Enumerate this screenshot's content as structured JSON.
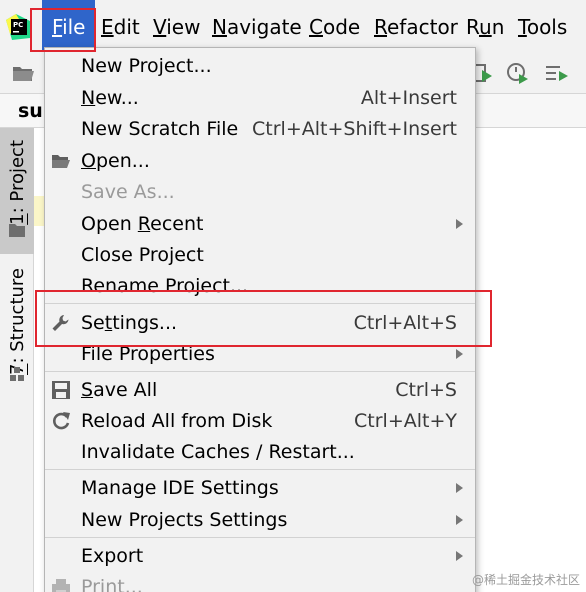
{
  "menubar": {
    "items": [
      {
        "pre": "",
        "mn": "F",
        "post": "ile"
      },
      {
        "pre": "",
        "mn": "E",
        "post": "dit"
      },
      {
        "pre": "",
        "mn": "V",
        "post": "iew"
      },
      {
        "pre": "",
        "mn": "N",
        "post": "avigate"
      },
      {
        "pre": "",
        "mn": "C",
        "post": "ode"
      },
      {
        "pre": "",
        "mn": "R",
        "post": "efactor"
      },
      {
        "pre": "R",
        "mn": "u",
        "post": "n"
      },
      {
        "pre": "",
        "mn": "T",
        "post": "ools"
      }
    ]
  },
  "tab": {
    "text": "sup"
  },
  "sidebar": {
    "project": {
      "mn": "1",
      "text": ": Project"
    },
    "structure": {
      "mn": "7",
      "text": ": Structure"
    }
  },
  "file_menu": {
    "items": [
      {
        "pre": "New Pro",
        "mn": "j",
        "post": "ect...",
        "shortcut": "",
        "submenu": false,
        "disabled": false,
        "icon": ""
      },
      {
        "pre": "",
        "mn": "N",
        "post": "ew...",
        "shortcut": "Alt+Insert",
        "submenu": false,
        "disabled": false,
        "icon": ""
      },
      {
        "pre": "New Scratch File",
        "mn": "",
        "post": "",
        "shortcut": "Ctrl+Alt+Shift+Insert",
        "submenu": false,
        "disabled": false,
        "icon": ""
      },
      {
        "pre": "",
        "mn": "O",
        "post": "pen...",
        "shortcut": "",
        "submenu": false,
        "disabled": false,
        "icon": "folder-open-icon"
      },
      {
        "pre": "Save As...",
        "mn": "",
        "post": "",
        "shortcut": "",
        "submenu": false,
        "disabled": true,
        "icon": ""
      },
      {
        "pre": "Open ",
        "mn": "R",
        "post": "ecent",
        "shortcut": "",
        "submenu": true,
        "disabled": false,
        "icon": ""
      },
      {
        "pre": "Close Project",
        "mn": "",
        "post": "",
        "shortcut": "",
        "submenu": false,
        "disabled": false,
        "icon": ""
      },
      {
        "pre": "Rename Project...",
        "mn": "",
        "post": "",
        "shortcut": "",
        "submenu": false,
        "disabled": false,
        "icon": ""
      },
      {
        "pre": "Se",
        "mn": "t",
        "post": "tings...",
        "shortcut": "Ctrl+Alt+S",
        "submenu": false,
        "disabled": false,
        "icon": "wrench-icon"
      },
      {
        "pre": "File Properties",
        "mn": "",
        "post": "",
        "shortcut": "",
        "submenu": true,
        "disabled": false,
        "icon": ""
      },
      {
        "pre": "",
        "mn": "S",
        "post": "ave All",
        "shortcut": "Ctrl+S",
        "submenu": false,
        "disabled": false,
        "icon": "save-icon"
      },
      {
        "pre": "Reload All from Disk",
        "mn": "",
        "post": "",
        "shortcut": "Ctrl+Alt+Y",
        "submenu": false,
        "disabled": false,
        "icon": "reload-icon"
      },
      {
        "pre": "Invalidate Caches / Restart...",
        "mn": "",
        "post": "",
        "shortcut": "",
        "submenu": false,
        "disabled": false,
        "icon": ""
      },
      {
        "pre": "Manage IDE Settings",
        "mn": "",
        "post": "",
        "shortcut": "",
        "submenu": true,
        "disabled": false,
        "icon": ""
      },
      {
        "pre": "New Projects Settings",
        "mn": "",
        "post": "",
        "shortcut": "",
        "submenu": true,
        "disabled": false,
        "icon": ""
      },
      {
        "pre": "Export",
        "mn": "",
        "post": "",
        "shortcut": "",
        "submenu": true,
        "disabled": false,
        "icon": ""
      },
      {
        "pre": "Print...",
        "mn": "",
        "post": "",
        "shortcut": "",
        "submenu": false,
        "disabled": true,
        "icon": "print-icon"
      }
    ]
  },
  "watermark": "@稀土掘金技术社区",
  "colors": {
    "accent": "#2f65ca",
    "annotation": "#e0262f",
    "run_green": "#3c9a4a"
  }
}
